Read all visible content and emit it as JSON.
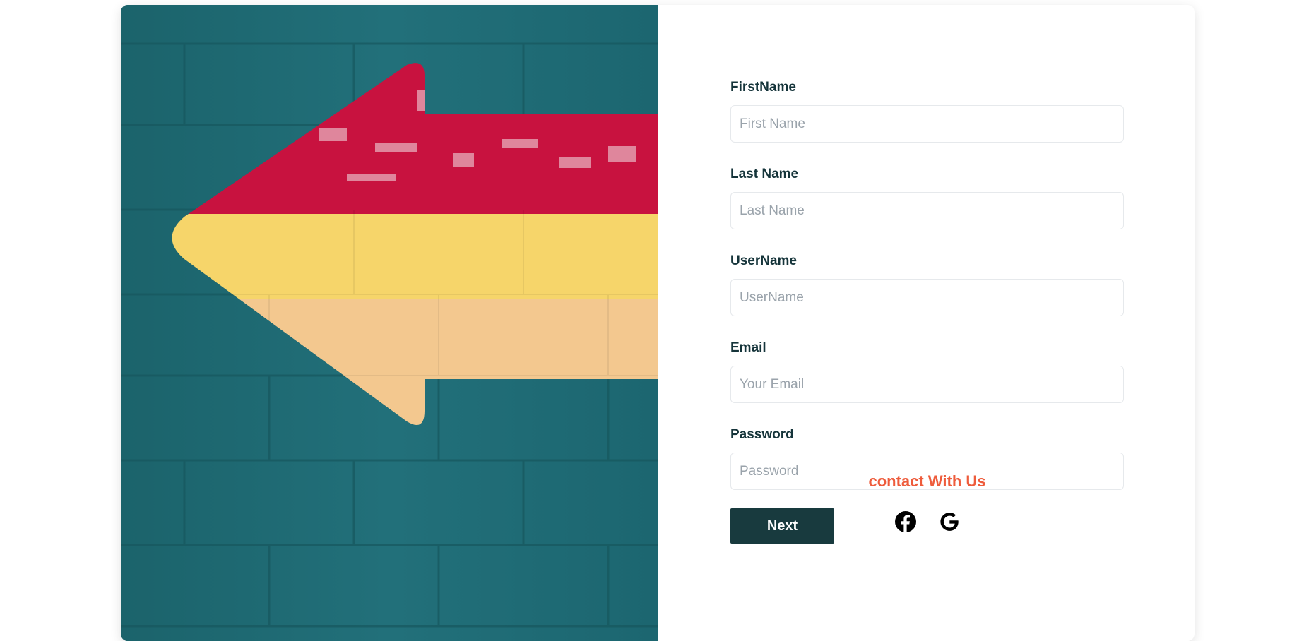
{
  "form": {
    "fields": [
      {
        "label": "FirstName",
        "placeholder": "First Name",
        "value": ""
      },
      {
        "label": "Last Name",
        "placeholder": "Last Name",
        "value": ""
      },
      {
        "label": "UserName",
        "placeholder": "UserName",
        "value": ""
      },
      {
        "label": "Email",
        "placeholder": "Your Email",
        "value": ""
      },
      {
        "label": "Password",
        "placeholder": "Password",
        "value": ""
      }
    ],
    "next_label": "Next"
  },
  "contact": {
    "heading": "contact With Us",
    "icons": [
      "facebook-icon",
      "google-icon"
    ]
  },
  "colors": {
    "wall": "#1f6a73",
    "arrow_red": "#c8123f",
    "arrow_yellow": "#f6d56a",
    "arrow_peach": "#f3c88f",
    "button": "#183a3e",
    "accent": "#ee5c3c",
    "label": "#15343a"
  }
}
